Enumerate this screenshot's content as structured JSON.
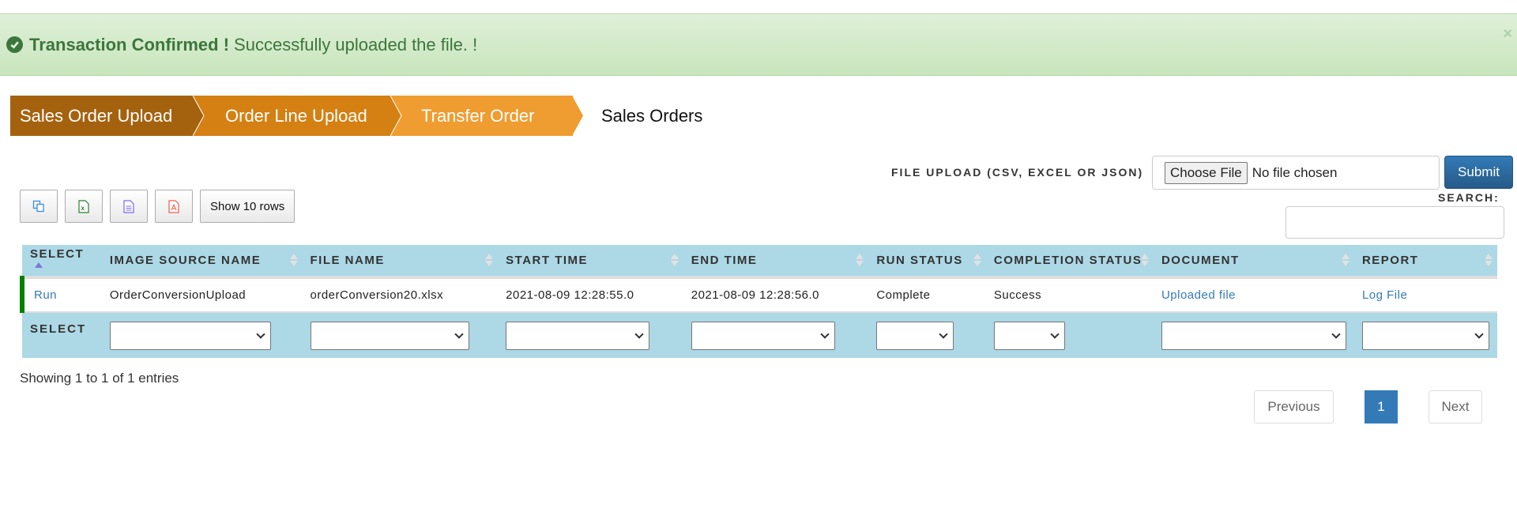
{
  "alert": {
    "title": "Transaction Confirmed !",
    "message": "Successfully uploaded the file. !",
    "close": "×",
    "color": "#3c763d"
  },
  "steps": [
    {
      "label": "Sales Order Upload",
      "color": "#a5620e"
    },
    {
      "label": "Order Line Upload",
      "color": "#d48013"
    },
    {
      "label": "Transfer Order",
      "color": "#ef9d30"
    },
    {
      "label": "Sales Orders"
    }
  ],
  "toolbar": {
    "buttons": [
      {
        "icon": "copy-icon"
      },
      {
        "icon": "excel-icon"
      },
      {
        "icon": "csv-icon"
      },
      {
        "icon": "pdf-icon"
      }
    ],
    "show_rows": "Show 10 rows"
  },
  "upload": {
    "label": "FILE UPLOAD (CSV, EXCEL OR JSON)",
    "choose": "Choose File",
    "status": "No file chosen",
    "submit": "Submit"
  },
  "search": {
    "label": "SEARCH:",
    "value": ""
  },
  "table": {
    "columns": [
      "SELECT",
      "IMAGE SOURCE NAME",
      "FILE NAME",
      "START TIME",
      "END TIME",
      "RUN STATUS",
      "COMPLETION STATUS",
      "DOCUMENT",
      "REPORT"
    ],
    "rows": [
      {
        "select": "Run",
        "image_source_name": "OrderConversionUpload",
        "file_name": "orderConversion20.xlsx",
        "start_time": "2021-08-09 12:28:55.0",
        "end_time": "2021-08-09 12:28:56.0",
        "run_status": "Complete",
        "completion_status": "Success",
        "document": "Uploaded file",
        "report": "Log File"
      }
    ],
    "footer_label": "SELECT"
  },
  "info": "Showing 1 to 1 of 1 entries",
  "pagination": {
    "previous": "Previous",
    "current": "1",
    "next": "Next"
  }
}
